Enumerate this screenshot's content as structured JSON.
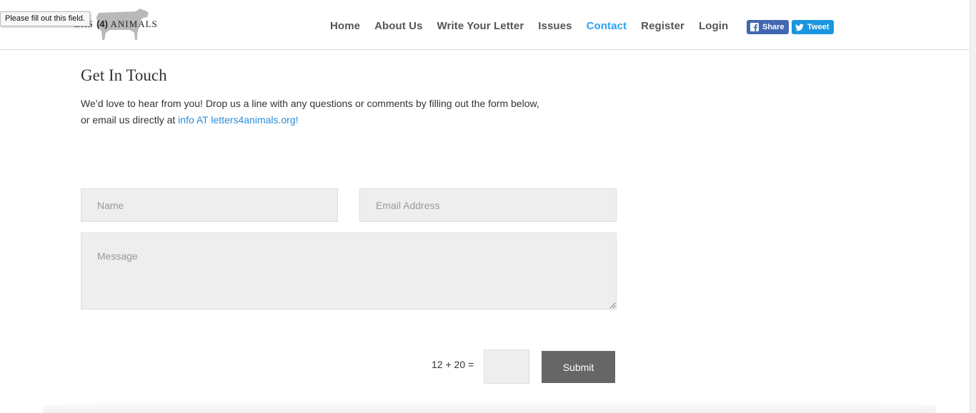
{
  "tooltip": {
    "text": "Please fill out this field."
  },
  "logo": {
    "text_before": "ERS",
    "text_number": "(4)",
    "text_after": "ANIMALS",
    "icon": "cow-silhouette"
  },
  "nav": {
    "items": [
      {
        "label": "Home",
        "active": false
      },
      {
        "label": "About Us",
        "active": false
      },
      {
        "label": "Write Your Letter",
        "active": false
      },
      {
        "label": "Issues",
        "active": false
      },
      {
        "label": "Contact",
        "active": true
      },
      {
        "label": "Register",
        "active": false
      },
      {
        "label": "Login",
        "active": false
      }
    ],
    "active_color": "#2ea3f2"
  },
  "social": {
    "share_label": "Share",
    "share_icon": "facebook-icon",
    "share_color": "#4267b2",
    "tweet_label": "Tweet",
    "tweet_icon": "twitter-icon",
    "tweet_color": "#1b95e0"
  },
  "main": {
    "title": "Get In Touch",
    "intro_text": "We’d love to hear from you! Drop us a line with any questions or comments by filling out the form below, or email us directly at",
    "intro_link": "info AT letters4animals.org!"
  },
  "form": {
    "name_placeholder": "Name",
    "email_placeholder": "Email Address",
    "message_placeholder": "Message",
    "captcha_question": "12 + 20 =",
    "captcha_value": "",
    "submit_label": "Submit"
  }
}
